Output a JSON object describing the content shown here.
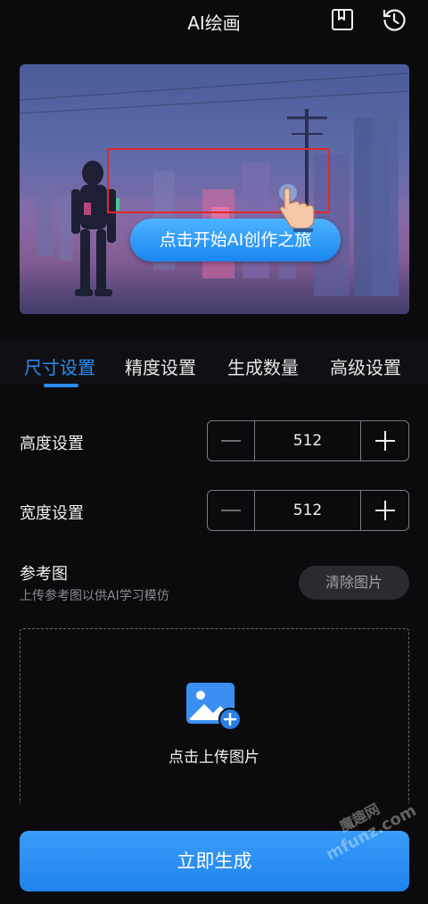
{
  "header": {
    "title": "AI绘画",
    "icons": {
      "bookmark": "bookmark-icon",
      "history": "history-icon"
    }
  },
  "banner": {
    "cta_label": "点击开始AI创作之旅"
  },
  "tabs": [
    {
      "label": "尺寸设置",
      "active": true
    },
    {
      "label": "精度设置",
      "active": false
    },
    {
      "label": "生成数量",
      "active": false
    },
    {
      "label": "高级设置",
      "active": false
    }
  ],
  "settings": {
    "height": {
      "label": "高度设置",
      "value": "512"
    },
    "width": {
      "label": "宽度设置",
      "value": "512"
    }
  },
  "reference": {
    "title": "参考图",
    "subtitle": "上传参考图以供AI学习模仿",
    "clear_label": "清除图片",
    "upload_label": "点击上传图片"
  },
  "generate_label": "立即生成",
  "watermark": {
    "text_cn": "魔趣网",
    "text_en": "mfunz.com"
  },
  "colors": {
    "accent": "#2a8cf0",
    "background": "#0b0b0d",
    "cta_highlight": "#e02a2a"
  }
}
